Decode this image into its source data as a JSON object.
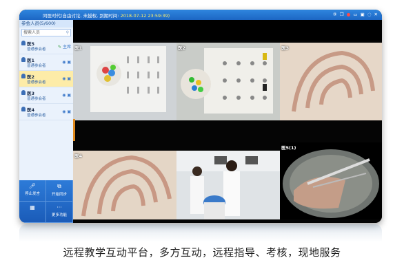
{
  "titlebar": {
    "title": "同医时代(自由讨论, 未授权, 到期时间:",
    "expiry": "2018-07-12 23:59:39)",
    "controls": [
      "③",
      "❐",
      "●",
      "▭",
      "▣",
      "◌",
      "✕"
    ]
  },
  "sidebar": {
    "header": "参会人员(5/600)",
    "search_placeholder": "搜索人员",
    "participants": [
      {
        "name": "医5",
        "role": "普通参会者",
        "selected": false,
        "badge": "主席"
      },
      {
        "name": "医1",
        "role": "普通参会者",
        "selected": false,
        "badge": ""
      },
      {
        "name": "医2",
        "role": "普通参会者",
        "selected": true,
        "badge": ""
      },
      {
        "name": "医3",
        "role": "普通参会者",
        "selected": false,
        "badge": ""
      },
      {
        "name": "医4",
        "role": "普通参会者",
        "selected": false,
        "badge": ""
      }
    ],
    "tools": [
      {
        "label": "停止发言",
        "icon": "mic-icon"
      },
      {
        "label": "开始同步",
        "icon": "sync-icon"
      },
      {
        "label": "",
        "icon": "grid-icon"
      },
      {
        "label": "更多功能",
        "icon": "more-icon"
      }
    ]
  },
  "videos": [
    {
      "label": "医1"
    },
    {
      "label": "医2"
    },
    {
      "label": "医3"
    },
    {
      "label": "医4"
    },
    {
      "label": ""
    },
    {
      "label": "医5(1)"
    }
  ],
  "caption": "远程教学互动平台，多方互动，远程指导、考核，现地服务"
}
